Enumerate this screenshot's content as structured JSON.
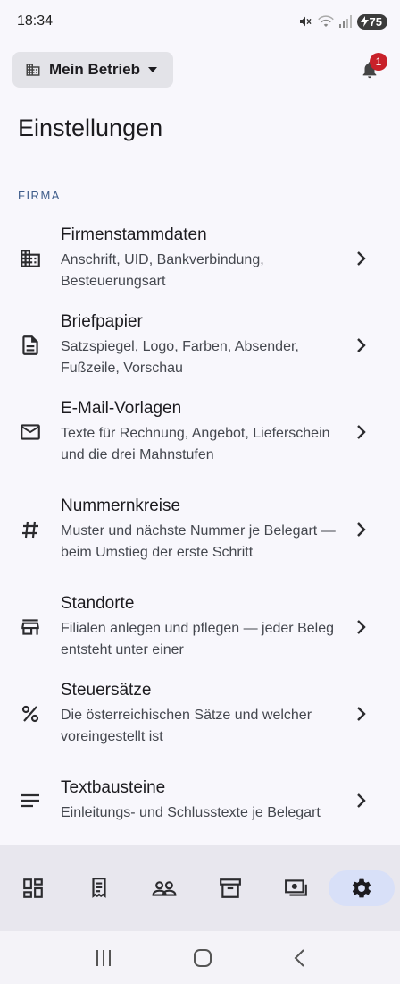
{
  "status_bar": {
    "time": "18:34",
    "battery": "75"
  },
  "top_bar": {
    "business_label": "Mein Betrieb",
    "notification_count": "1"
  },
  "page": {
    "title": "Einstellungen"
  },
  "section": {
    "header": "FIRMA"
  },
  "items": [
    {
      "title": "Firmenstammdaten",
      "subtitle": "Anschrift, UID, Bankverbindung, Besteuerungsart",
      "icon": "business-icon"
    },
    {
      "title": "Briefpapier",
      "subtitle": "Satzspiegel, Logo, Farben, Absender, Fußzeile, Vorschau",
      "icon": "document-icon"
    },
    {
      "title": "E-Mail-Vorlagen",
      "subtitle": "Texte für Rechnung, Angebot, Lieferschein und die drei Mahnstufen",
      "icon": "mail-icon"
    },
    {
      "title": "Nummernkreise",
      "subtitle": "Muster und nächste Nummer je Belegart — beim Umstieg der erste Schritt",
      "icon": "hash-icon"
    },
    {
      "title": "Standorte",
      "subtitle": "Filialen anlegen und pflegen — jeder Beleg entsteht unter einer",
      "icon": "store-icon"
    },
    {
      "title": "Steuersätze",
      "subtitle": "Die österreichischen Sätze und welcher voreingestellt ist",
      "icon": "percent-icon"
    },
    {
      "title": "Textbausteine",
      "subtitle": "Einleitungs- und Schlusstexte je Belegart",
      "icon": "text-lines-icon"
    }
  ],
  "bottom_nav": [
    {
      "icon": "dashboard-icon",
      "active": false
    },
    {
      "icon": "receipt-icon",
      "active": false
    },
    {
      "icon": "people-icon",
      "active": false
    },
    {
      "icon": "archive-icon",
      "active": false
    },
    {
      "icon": "payments-icon",
      "active": false
    },
    {
      "icon": "settings-icon",
      "active": true
    }
  ],
  "colors": {
    "background": "#f8f7fc",
    "section_header": "#3e5c8a",
    "badge": "#c8212a",
    "nav_active": "#d8e0f8"
  }
}
